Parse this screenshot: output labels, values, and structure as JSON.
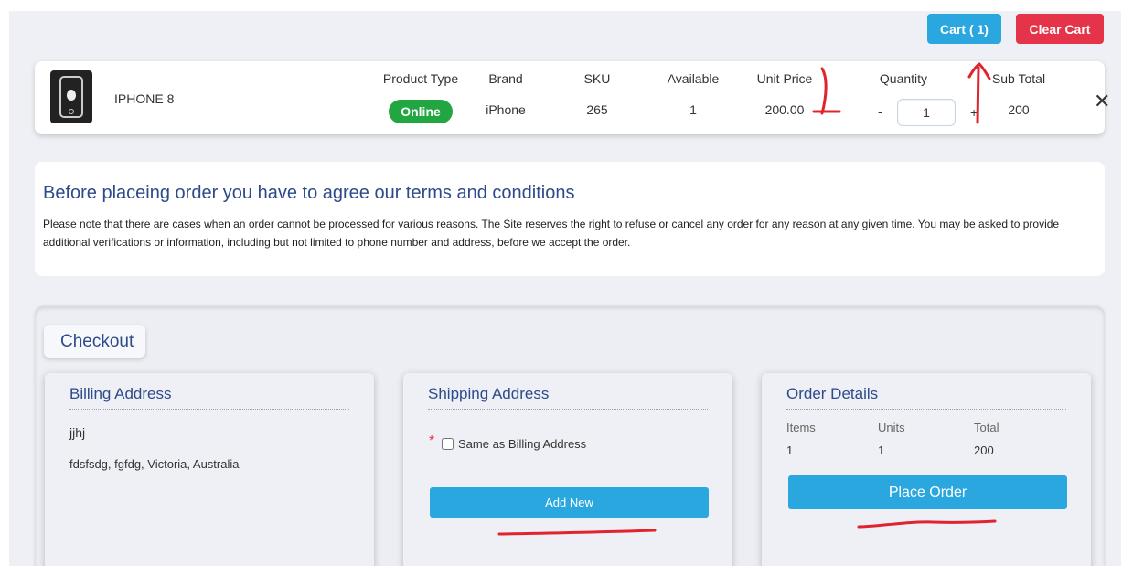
{
  "header": {
    "cart_label": "Cart ( 1)",
    "clear_cart_label": "Clear Cart"
  },
  "cart": {
    "headers": {
      "product_type": "Product Type",
      "brand": "Brand",
      "sku": "SKU",
      "available": "Available",
      "unit_price": "Unit Price",
      "quantity": "Quantity",
      "sub_total": "Sub Total"
    },
    "item": {
      "name": "IPHONE 8",
      "product_type": "Online",
      "brand": "iPhone",
      "sku": "265",
      "available": "1",
      "unit_price": "200.00",
      "quantity": "1",
      "qty_minus": "-",
      "qty_plus": "+",
      "sub_total": "200",
      "remove": "✕",
      "image_icon": "iphone-icon"
    }
  },
  "terms": {
    "title": "Before placeing order you have to agree our terms and conditions",
    "body": "Please note that there are cases when an order cannot be processed for various reasons. The Site reserves the right to refuse or cancel any order for any reason at any given time. You may be asked to provide additional verifications or information, including but not limited to phone number and address, before we accept the order."
  },
  "checkout": {
    "title": "Checkout",
    "billing": {
      "title": "Billing Address",
      "name": "jjhj",
      "address": "fdsfsdg, fgfdg, Victoria, Australia"
    },
    "shipping": {
      "title": "Shipping Address",
      "required_mark": "*",
      "same_as_billing_label": "Same as Billing Address",
      "add_new_label": "Add New"
    },
    "order": {
      "title": "Order Details",
      "headers": {
        "items": "Items",
        "units": "Units",
        "total": "Total"
      },
      "values": {
        "items": "1",
        "units": "1",
        "total": "200"
      },
      "place_order_label": "Place Order"
    }
  },
  "colors": {
    "primary_button": "#2ba7e0",
    "danger_button": "#e53349",
    "badge_online": "#21a642",
    "heading_blue": "#2d4a8a",
    "annotation_red": "#e0242e"
  }
}
